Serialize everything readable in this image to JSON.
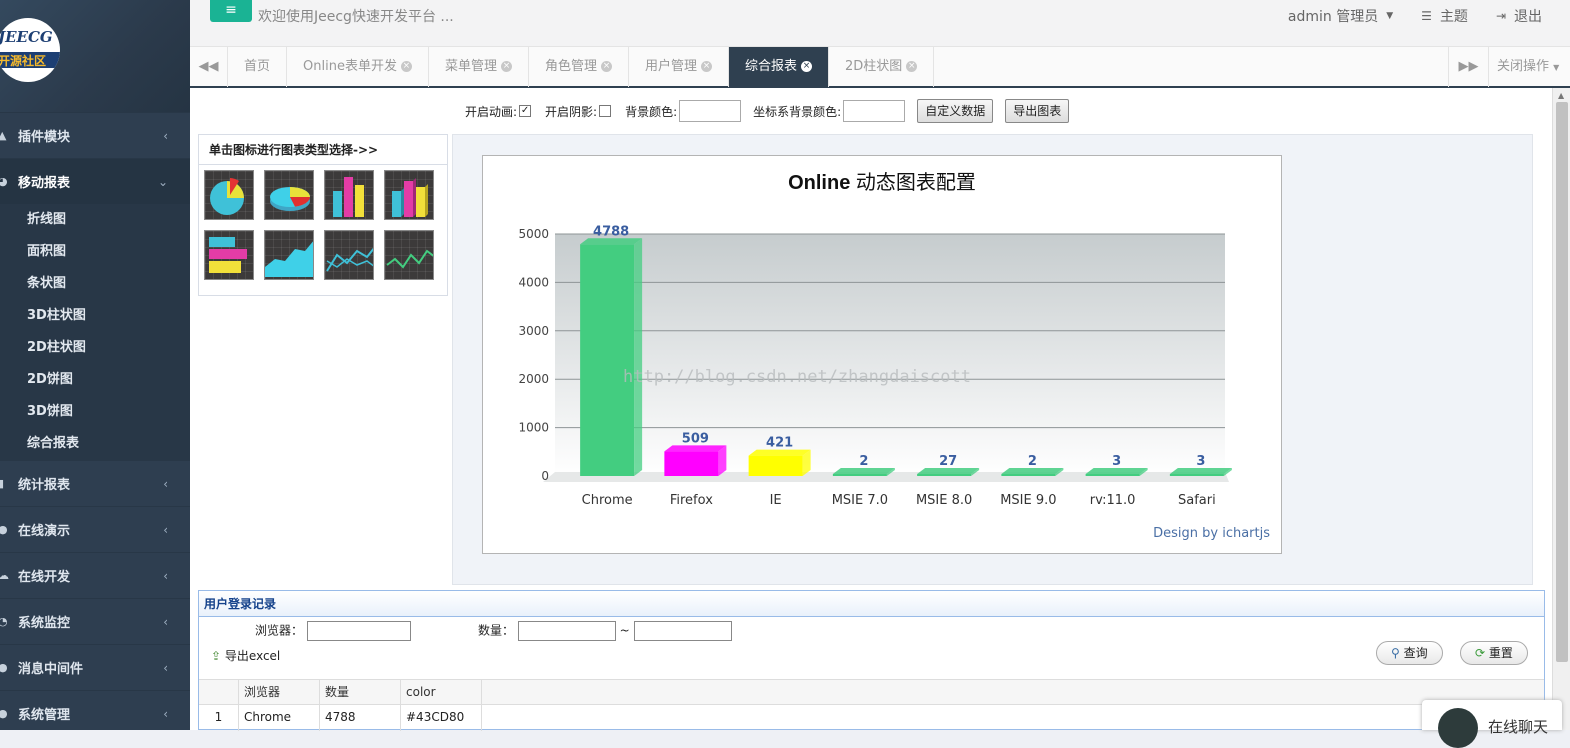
{
  "sidebar": {
    "logo": {
      "line1": "JEECG",
      "line2": "开源社区"
    },
    "groups": [
      {
        "label": "插件模块",
        "icon": "plugin-icon"
      },
      {
        "label": "移动报表",
        "icon": "pie-chart-icon"
      },
      {
        "label": "统计报表",
        "icon": "bar-chart-icon"
      },
      {
        "label": "在线演示",
        "icon": "play-icon"
      },
      {
        "label": "在线开发",
        "icon": "cloud-icon"
      },
      {
        "label": "系统监控",
        "icon": "monitor-icon"
      },
      {
        "label": "消息中间件",
        "icon": "message-icon"
      },
      {
        "label": "系统管理",
        "icon": "settings-icon"
      }
    ],
    "submenu": [
      "折线图",
      "面积图",
      "条状图",
      "3D柱状图",
      "2D柱状图",
      "2D饼图",
      "3D饼图",
      "综合报表"
    ]
  },
  "topbar": {
    "menu_toggle": "≡",
    "welcome": "欢迎使用Jeecg快速开发平台 ...",
    "user": "admin 管理员",
    "theme": "主题",
    "logout": "退出"
  },
  "tabs": {
    "items": [
      {
        "label": "首页",
        "closable": false,
        "active": false
      },
      {
        "label": "Online表单开发",
        "closable": true,
        "active": false
      },
      {
        "label": "菜单管理",
        "closable": true,
        "active": false
      },
      {
        "label": "角色管理",
        "closable": true,
        "active": false
      },
      {
        "label": "用户管理",
        "closable": true,
        "active": false
      },
      {
        "label": "综合报表",
        "closable": true,
        "active": true
      },
      {
        "label": "2D柱状图",
        "closable": true,
        "active": false
      }
    ],
    "close_ops": "关闭操作"
  },
  "toolbar": {
    "animation_label": "开启动画:",
    "animation_checked": true,
    "shadow_label": "开启阴影:",
    "shadow_checked": false,
    "bg_color_label": "背景颜色:",
    "bg_color_value": "",
    "axis_bg_color_label": "坐标系背景颜色:",
    "axis_bg_color_value": "",
    "custom_data_button": "自定义数据",
    "export_chart_button": "导出图表"
  },
  "chart_picker": {
    "title": "单击图标进行图表类型选择->>",
    "icons": [
      "pie-chart-icon",
      "3d-pie-chart-icon",
      "column-chart-icon",
      "3d-column-chart-icon",
      "bar-chart-icon",
      "area-chart-icon",
      "line-chart-icon",
      "spline-chart-icon"
    ]
  },
  "chart_data": {
    "type": "bar",
    "title_bold": "Online",
    "title_rest": "动态图表配置",
    "categories": [
      "Chrome",
      "Firefox",
      "IE",
      "MSIE 7.0",
      "MSIE 8.0",
      "MSIE 9.0",
      "rv:11.0",
      "Safari"
    ],
    "values": [
      4788,
      509,
      421,
      2,
      27,
      2,
      3,
      3
    ],
    "colors": [
      "#43CD80",
      "#FF00FF",
      "#FFFF00",
      "#43CD80",
      "#43CD80",
      "#43CD80",
      "#43CD80",
      "#43CD80"
    ],
    "ylim": [
      0,
      5000
    ],
    "yticks": [
      0,
      1000,
      2000,
      3000,
      4000,
      5000
    ],
    "credit": "Design by ichartjs",
    "watermark": "http://blog.csdn.net/zhangdaiscott"
  },
  "grid": {
    "title": "用户登录记录",
    "filter_browser_label": "浏览器：",
    "filter_count_label": "数量：",
    "range_sep": "~",
    "export_excel": "导出excel",
    "query_button": "查询",
    "reset_button": "重置",
    "columns": [
      "浏览器",
      "数量",
      "color"
    ],
    "rows": [
      {
        "no": "1",
        "browser": "Chrome",
        "count": "4788",
        "color": "#43CD80"
      }
    ]
  },
  "chat": {
    "label": "在线聊天"
  }
}
